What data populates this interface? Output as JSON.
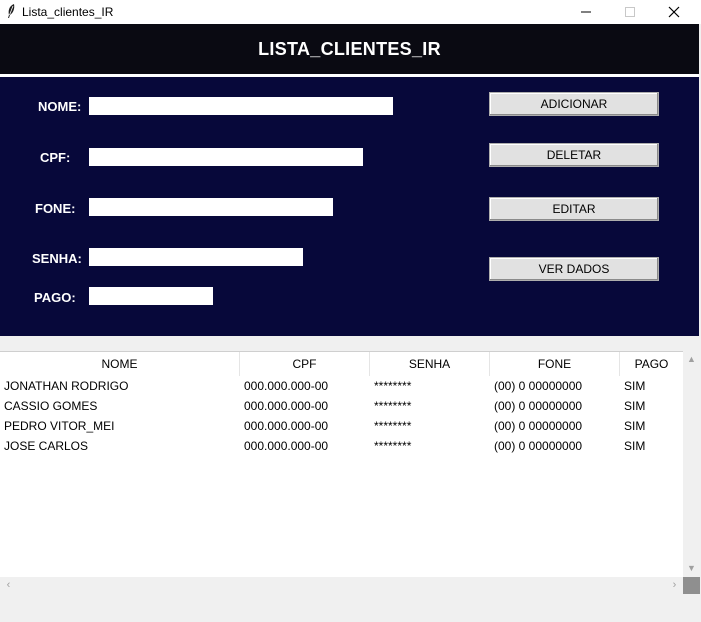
{
  "window": {
    "title": "Lista_clientes_IR",
    "icon": "feather-icon"
  },
  "header": {
    "title": "LISTA_CLIENTES_IR"
  },
  "form": {
    "fields": [
      {
        "label": "NOME:",
        "value": ""
      },
      {
        "label": "CPF:",
        "value": ""
      },
      {
        "label": "FONE:",
        "value": ""
      },
      {
        "label": "SENHA:",
        "value": ""
      },
      {
        "label": "PAGO:",
        "value": ""
      }
    ],
    "buttons": {
      "add": "ADICIONAR",
      "delete": "DELETAR",
      "edit": "EDITAR",
      "view": "VER DADOS"
    }
  },
  "table": {
    "columns": [
      "NOME",
      "CPF",
      "SENHA",
      "FONE",
      "PAGO"
    ],
    "rows": [
      [
        "JONATHAN RODRIGO",
        "000.000.000-00",
        "********",
        "(00) 0 00000000",
        "SIM"
      ],
      [
        "CASSIO GOMES",
        "000.000.000-00",
        "********",
        "(00) 0 00000000",
        "SIM"
      ],
      [
        "PEDRO VITOR_MEI",
        "000.000.000-00",
        "********",
        "(00) 0 00000000",
        "SIM"
      ],
      [
        "JOSE CARLOS",
        "000.000.000-00",
        "********",
        "(00) 0 00000000",
        "SIM"
      ]
    ]
  },
  "colors": {
    "header_bg": "#0a0a12",
    "form_bg": "#07083a",
    "button_bg": "#e1e1e1"
  }
}
